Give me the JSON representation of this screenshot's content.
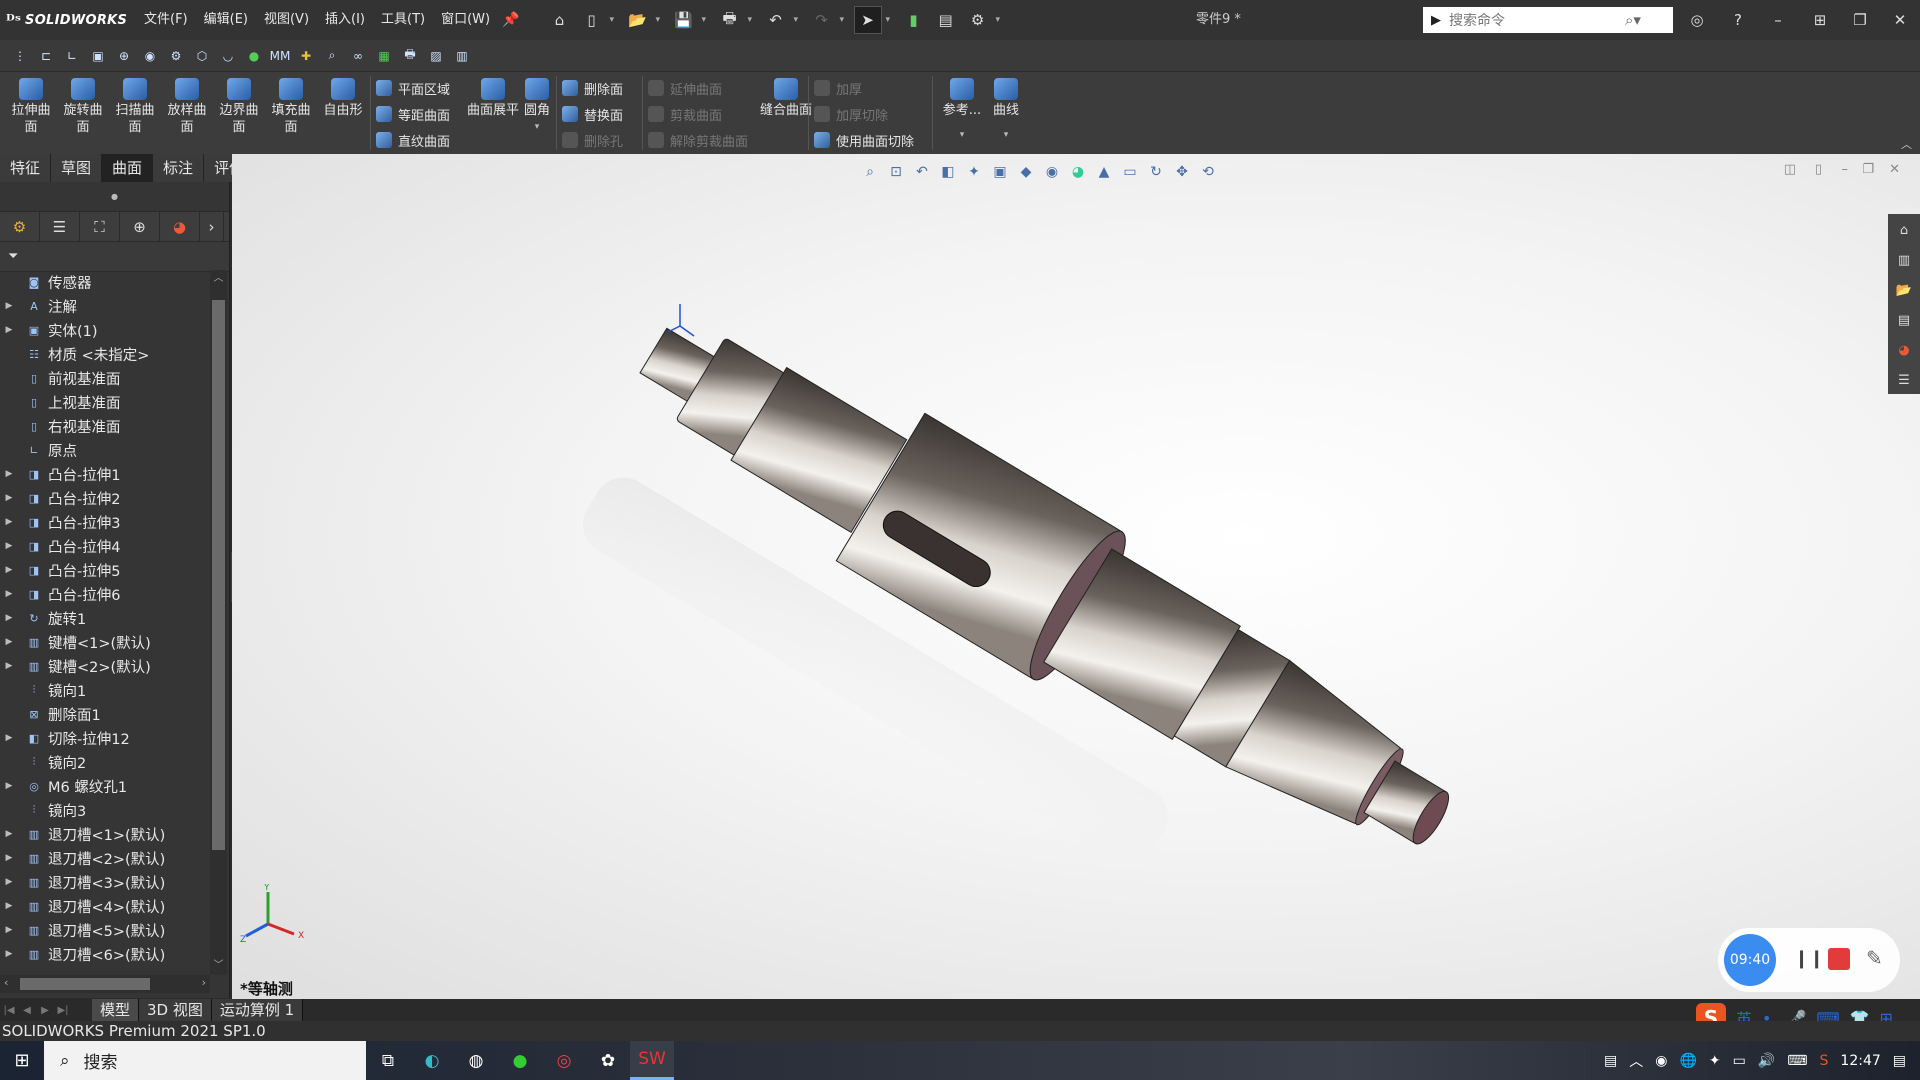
{
  "app": {
    "logo_ds": "ᴰˢ",
    "logo_text": "SOLIDWORKS",
    "document_title": "零件9 *"
  },
  "menu": [
    "文件(F)",
    "编辑(E)",
    "视图(V)",
    "插入(I)",
    "工具(T)",
    "窗口(W)"
  ],
  "search": {
    "placeholder": "搜索命令"
  },
  "command_manager": {
    "large_buttons": [
      {
        "label": "拉伸曲面",
        "icon": "extrude-surface-icon"
      },
      {
        "label": "旋转曲面",
        "icon": "revolve-surface-icon"
      },
      {
        "label": "扫描曲面",
        "icon": "sweep-surface-icon"
      },
      {
        "label": "放样曲面",
        "icon": "loft-surface-icon"
      },
      {
        "label": "边界曲面",
        "icon": "boundary-surface-icon"
      },
      {
        "label": "填充曲面",
        "icon": "fill-surface-icon"
      },
      {
        "label": "自由形",
        "icon": "freeform-icon"
      }
    ],
    "group1": [
      {
        "label": "平面区域",
        "enabled": true
      },
      {
        "label": "等距曲面",
        "enabled": true
      },
      {
        "label": "直纹曲面",
        "enabled": true
      }
    ],
    "flatten": "曲面展平",
    "fillet": "圆角",
    "group2": [
      {
        "label": "删除面",
        "enabled": true
      },
      {
        "label": "替换面",
        "enabled": true
      },
      {
        "label": "删除孔",
        "enabled": false
      }
    ],
    "group3": [
      {
        "label": "延伸曲面",
        "enabled": false
      },
      {
        "label": "剪裁曲面",
        "enabled": false
      },
      {
        "label": "解除剪裁曲面",
        "enabled": false
      }
    ],
    "knit": "缝合曲面",
    "group4": [
      {
        "label": "加厚",
        "enabled": false
      },
      {
        "label": "加厚切除",
        "enabled": false
      },
      {
        "label": "使用曲面切除",
        "enabled": true
      }
    ],
    "reference": "参考...",
    "curves": "曲线"
  },
  "tabs": [
    {
      "label": "特征",
      "active": false
    },
    {
      "label": "草图",
      "active": false
    },
    {
      "label": "曲面",
      "active": true
    },
    {
      "label": "标注",
      "active": false
    },
    {
      "label": "评估",
      "active": false
    }
  ],
  "tree": [
    {
      "label": "传感器",
      "expandable": false,
      "icon": "sensor-icon"
    },
    {
      "label": "注解",
      "expandable": true,
      "icon": "annotation-icon"
    },
    {
      "label": "实体(1)",
      "expandable": true,
      "icon": "solid-body-icon"
    },
    {
      "label": "材质 <未指定>",
      "expandable": false,
      "icon": "material-icon"
    },
    {
      "label": "前视基准面",
      "expandable": false,
      "icon": "plane-icon"
    },
    {
      "label": "上视基准面",
      "expandable": false,
      "icon": "plane-icon"
    },
    {
      "label": "右视基准面",
      "expandable": false,
      "icon": "plane-icon"
    },
    {
      "label": "原点",
      "expandable": false,
      "icon": "origin-icon"
    },
    {
      "label": "凸台-拉伸1",
      "expandable": true,
      "icon": "boss-extrude-icon"
    },
    {
      "label": "凸台-拉伸2",
      "expandable": true,
      "icon": "boss-extrude-icon"
    },
    {
      "label": "凸台-拉伸3",
      "expandable": true,
      "icon": "boss-extrude-icon"
    },
    {
      "label": "凸台-拉伸4",
      "expandable": true,
      "icon": "boss-extrude-icon"
    },
    {
      "label": "凸台-拉伸5",
      "expandable": true,
      "icon": "boss-extrude-icon"
    },
    {
      "label": "凸台-拉伸6",
      "expandable": true,
      "icon": "boss-extrude-icon"
    },
    {
      "label": "旋转1",
      "expandable": true,
      "icon": "revolve-icon"
    },
    {
      "label": "键槽<1>(默认)",
      "expandable": true,
      "icon": "library-feature-icon"
    },
    {
      "label": "键槽<2>(默认)",
      "expandable": true,
      "icon": "library-feature-icon"
    },
    {
      "label": "镜向1",
      "expandable": false,
      "icon": "mirror-icon"
    },
    {
      "label": "删除面1",
      "expandable": false,
      "icon": "delete-face-icon"
    },
    {
      "label": "切除-拉伸12",
      "expandable": true,
      "icon": "cut-extrude-icon"
    },
    {
      "label": "镜向2",
      "expandable": false,
      "icon": "mirror-icon"
    },
    {
      "label": "M6 螺纹孔1",
      "expandable": true,
      "icon": "hole-wizard-icon"
    },
    {
      "label": "镜向3",
      "expandable": false,
      "icon": "mirror-icon"
    },
    {
      "label": "退刀槽<1>(默认)",
      "expandable": true,
      "icon": "library-feature-icon"
    },
    {
      "label": "退刀槽<2>(默认)",
      "expandable": true,
      "icon": "library-feature-icon"
    },
    {
      "label": "退刀槽<3>(默认)",
      "expandable": true,
      "icon": "library-feature-icon"
    },
    {
      "label": "退刀槽<4>(默认)",
      "expandable": true,
      "icon": "library-feature-icon"
    },
    {
      "label": "退刀槽<5>(默认)",
      "expandable": true,
      "icon": "library-feature-icon"
    },
    {
      "label": "退刀槽<6>(默认)",
      "expandable": true,
      "icon": "library-feature-icon"
    }
  ],
  "viewport": {
    "view_name": "*等轴测",
    "triad": {
      "x": "X",
      "y": "Y",
      "z": "Z"
    }
  },
  "recorder": {
    "time": "09:40"
  },
  "bottom_tabs": [
    {
      "label": "模型",
      "active": true
    },
    {
      "label": "3D 视图",
      "active": false
    },
    {
      "label": "运动算例 1",
      "active": false
    }
  ],
  "status": "SOLIDWORKS Premium 2021 SP1.0",
  "ime": {
    "lang": "英"
  },
  "taskbar": {
    "search_label": "搜索",
    "clock": "12:47"
  }
}
